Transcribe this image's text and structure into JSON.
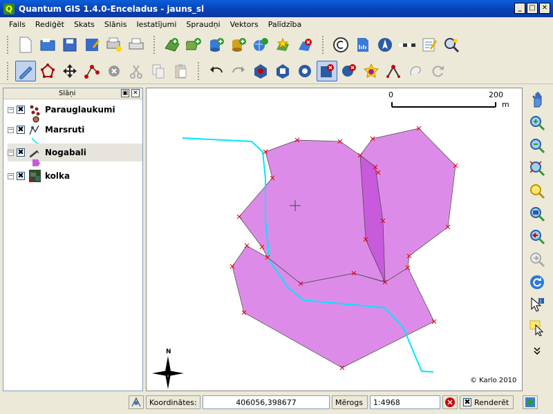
{
  "window": {
    "title": "Quantum GIS 1.4.0-Enceladus - jauns_sl",
    "minimize": "_",
    "maximize": "□",
    "close": "✕"
  },
  "menubar": {
    "items": [
      "Fails",
      "Rediģēt",
      "Skats",
      "Slānis",
      "Iestatījumi",
      "Spraudņi",
      "Vektors",
      "Palīdzība"
    ]
  },
  "dock": {
    "title": "Slāņi",
    "float_label": "▣",
    "close_label": "✕"
  },
  "layers": [
    {
      "name": "Parauglaukumi",
      "checked": "✖",
      "expand": "−",
      "icon": "point-layer-icon"
    },
    {
      "name": "Marsruti",
      "checked": "✖",
      "expand": "−",
      "icon": "line-layer-icon"
    },
    {
      "name": "Nogabali",
      "checked": "✖",
      "expand": "−",
      "icon": "polygon-layer-icon",
      "selected": true
    },
    {
      "name": "kolka",
      "checked": "✖",
      "expand": "−",
      "icon": "raster-layer-icon"
    }
  ],
  "map": {
    "scalebar": {
      "start": "0",
      "end": "200",
      "unit": "m"
    },
    "copyright": "© Karlo 2010",
    "north_arrow": "N",
    "colors": {
      "polygon_fill": "#dc8ce8",
      "polygon_selected": "#c85adc",
      "polygon_edge": "#333333",
      "vertex": "#e00000",
      "route": "#00e5ff"
    }
  },
  "statusbar": {
    "coords_label": "Koordinātes:",
    "coords_value": "406056,398677",
    "scale_label": "Mērogs",
    "scale_value": "1:4968",
    "render_label": "Renderēt",
    "render_checked": "✖"
  },
  "toolbar1_icons": [
    "new-project-icon",
    "open-project-icon",
    "save-project-icon",
    "save-as-icon",
    "new-print-composer-icon",
    "print-icon",
    "add-vector-layer-icon",
    "add-raster-layer-icon",
    "add-postgis-layer-icon",
    "add-spatialite-layer-icon",
    "add-wms-layer-icon",
    "new-vector-layer-icon",
    "remove-layer-icon",
    "copyright-label-icon",
    "scale-bar-icon",
    "north-arrow-icon",
    "measure-line-icon",
    "annotation-icon",
    "zoom-plugin-icon"
  ],
  "toolbar2_icons": [
    "toggle-editing-icon",
    "capture-polygon-icon",
    "move-feature-icon",
    "node-tool-icon",
    "delete-selected-icon",
    "cut-icon",
    "copy-icon",
    "paste-icon",
    "undo-icon",
    "redo-icon",
    "add-ring-icon",
    "add-island-icon",
    "delete-ring-icon",
    "delete-part-icon",
    "reshape-icon",
    "split-features-icon",
    "merge-features-icon",
    "rotate-icon",
    "offset-icon"
  ],
  "right_toolbar_icons": [
    "pan-icon",
    "zoom-in-icon",
    "zoom-out-icon",
    "zoom-full-icon",
    "zoom-to-selection-icon",
    "zoom-to-layer-icon",
    "zoom-last-icon",
    "zoom-next-icon",
    "refresh-icon",
    "identify-icon",
    "select-icon",
    "more-icon"
  ]
}
